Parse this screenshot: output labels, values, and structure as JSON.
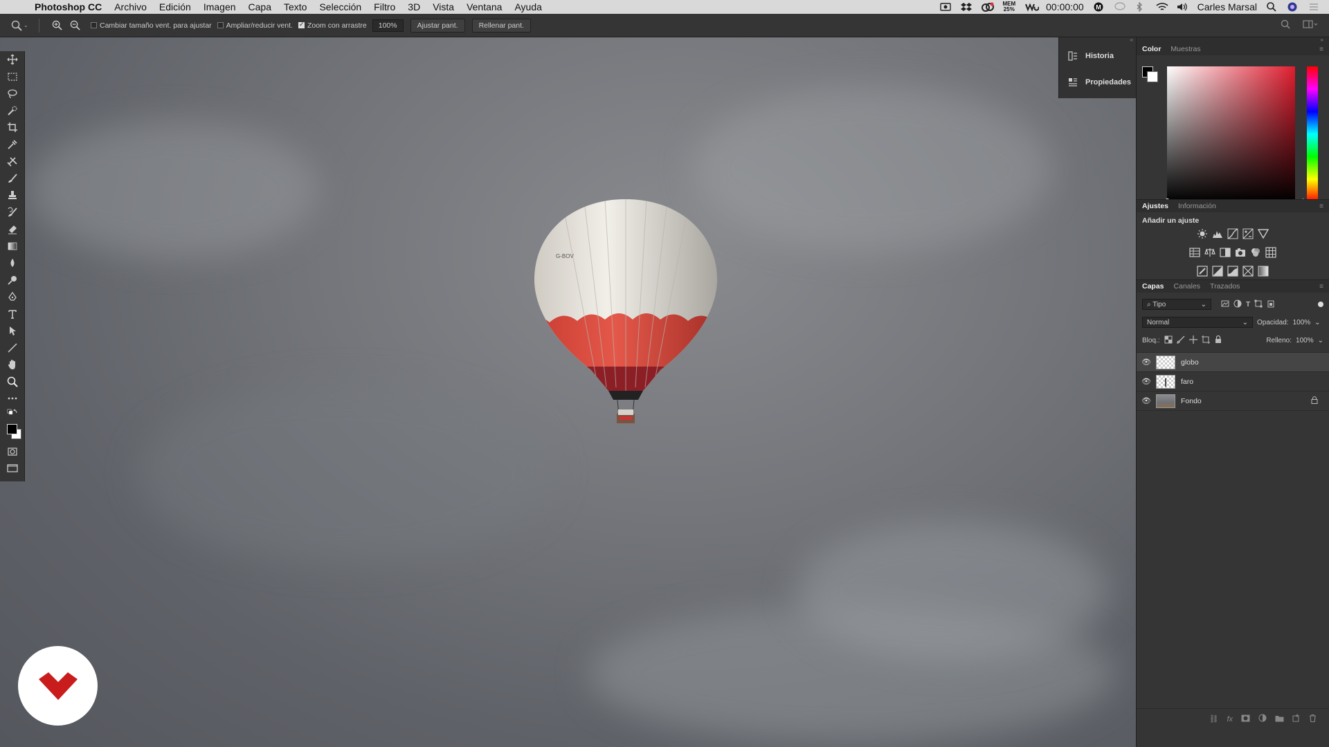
{
  "menubar": {
    "app_name": "Photoshop CC",
    "menus": [
      "Archivo",
      "Edición",
      "Imagen",
      "Capa",
      "Texto",
      "Selección",
      "Filtro",
      "3D",
      "Vista",
      "Ventana",
      "Ayuda"
    ],
    "mem_label": "MEM",
    "mem_value": "25%",
    "timer": "00:00:00",
    "user": "Carles Marsal"
  },
  "options": {
    "resize_windows": "Cambiar tamaño vent. para ajustar",
    "zoom_all": "Ampliar/reducir vent.",
    "scrubby_zoom": "Zoom con arrastre",
    "zoom_value": "100%",
    "fit_screen": "Ajustar pant.",
    "fill_screen": "Rellenar pant."
  },
  "floatpanel": {
    "history": "Historia",
    "properties": "Propiedades"
  },
  "color_panel": {
    "tab_color": "Color",
    "tab_swatches": "Muestras",
    "hue_color": "#e01d2f"
  },
  "adjust_panel": {
    "tab_adjust": "Ajustes",
    "tab_info": "Información",
    "add_adjust": "Añadir un ajuste"
  },
  "layers_panel": {
    "tab_layers": "Capas",
    "tab_channels": "Canales",
    "tab_paths": "Trazados",
    "filter_kind": "Tipo",
    "blend_mode": "Normal",
    "opacity_label": "Opacidad:",
    "opacity_value": "100%",
    "lock_label": "Bloq.:",
    "fill_label": "Relleno:",
    "fill_value": "100%",
    "layers": [
      {
        "name": "globo",
        "selected": true
      },
      {
        "name": "faro",
        "selected": false
      },
      {
        "name": "Fondo",
        "selected": false,
        "locked": true
      }
    ]
  },
  "colors": {
    "balloon_red": "#d84336",
    "logo_red": "#c91c1c"
  }
}
